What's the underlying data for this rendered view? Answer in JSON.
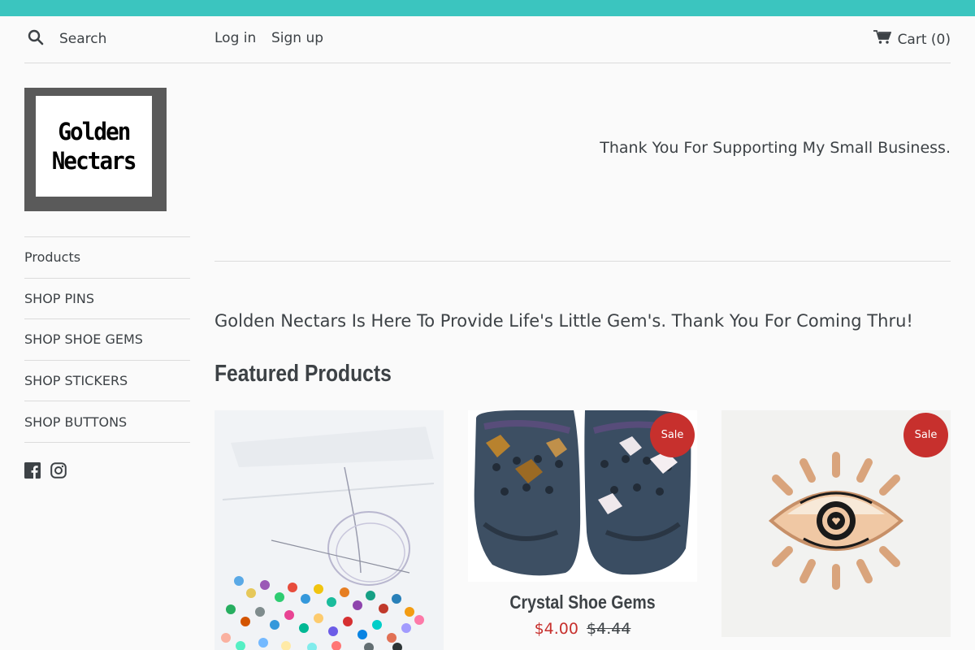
{
  "header": {
    "search_placeholder": "Search",
    "login_label": "Log in",
    "signup_label": "Sign up",
    "cart_label": "Cart (0)"
  },
  "logo": {
    "line1": "Golden",
    "line2": "Nectars"
  },
  "sidebar": {
    "items": [
      {
        "label": "Products"
      },
      {
        "label": "SHOP PINS"
      },
      {
        "label": "SHOP SHOE GEMS"
      },
      {
        "label": "SHOP STICKERS"
      },
      {
        "label": "SHOP BUTTONS"
      }
    ],
    "social": [
      {
        "icon": "facebook-icon"
      },
      {
        "icon": "instagram-icon"
      }
    ]
  },
  "main": {
    "tagline": "Thank You For Supporting My Small Business.",
    "intro": "Golden Nectars Is Here To Provide Life's Little Gem's. Thank You For Coming Thru!",
    "featured_title": "Featured Products"
  },
  "products": [
    {
      "title": "",
      "badge": "",
      "price": "",
      "compare_price": ""
    },
    {
      "title": "Crystal Shoe Gems",
      "badge": "Sale",
      "price": "$4.00",
      "compare_price": "$4.44"
    },
    {
      "title": "",
      "badge": "Sale",
      "price": "",
      "compare_price": ""
    }
  ],
  "colors": {
    "announcement_bar": "#3bc5bf",
    "sale_badge": "#c7302d",
    "text": "#3d4246",
    "background": "#fafafa"
  }
}
